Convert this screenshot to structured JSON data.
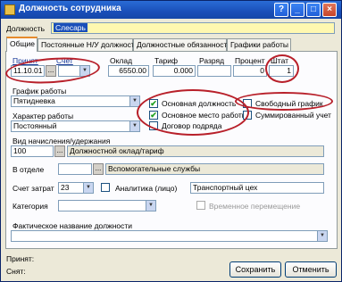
{
  "window": {
    "title": "Должность сотрудника",
    "minimize": "_",
    "maximize": "□",
    "close": "×",
    "help": "?"
  },
  "position": {
    "label": "Должность",
    "value": "Слесарь"
  },
  "tabs": [
    {
      "label": "Общие"
    },
    {
      "label": "Постоянные Н/У должности"
    },
    {
      "label": "Должностные обязанности"
    },
    {
      "label": "Графики работы"
    }
  ],
  "row1": {
    "hired_label": "Принят",
    "hired_value": "11.10.01",
    "account_label": "Счет",
    "account_value": "",
    "salary_label": "Оклад",
    "salary_value": "6550.00",
    "tariff_label": "Тариф",
    "tariff_value": "0.000",
    "grade_label": "Разряд",
    "grade_value": "",
    "percent_label": "Процент",
    "percent_value": "0",
    "staff_label": "Штат",
    "staff_value": "1"
  },
  "schedule": {
    "label": "График работы",
    "value": "Пятидневка"
  },
  "work_type": {
    "label": "Характер работы",
    "value": "Постоянный"
  },
  "checkboxes": {
    "main_position": {
      "label": "Основная должность",
      "checked": true
    },
    "main_workplace": {
      "label": "Основное место работы",
      "checked": true
    },
    "contract": {
      "label": "Договор подряда",
      "checked": false
    },
    "free_schedule": {
      "label": "Свободный график",
      "checked": false
    },
    "summarized": {
      "label": "Суммированный учет",
      "checked": false
    },
    "temp_transfer": {
      "label": "Временное перемещение",
      "checked": false
    }
  },
  "accrual": {
    "label": "Вид начисления/удержания",
    "code": "100",
    "name": "Должностной оклад/тариф"
  },
  "department": {
    "label": "В отделе",
    "code": "",
    "name": "Вспомогательные службы"
  },
  "cost_account": {
    "label": "Счет затрат",
    "value": "23"
  },
  "analytics": {
    "label": "Аналитика (лицо)",
    "value": "Транспортный цех"
  },
  "category": {
    "label": "Категория",
    "value": ""
  },
  "actual_name": {
    "label": "Фактическое название должности",
    "value": ""
  },
  "footer": {
    "hired_label": "Принят:",
    "removed_label": "Снят:",
    "save": "Сохранить",
    "cancel": "Отменить"
  },
  "colors": {
    "annotation": "#b8202a",
    "title_bar": "#1a4fb9",
    "check": "#21a121"
  }
}
